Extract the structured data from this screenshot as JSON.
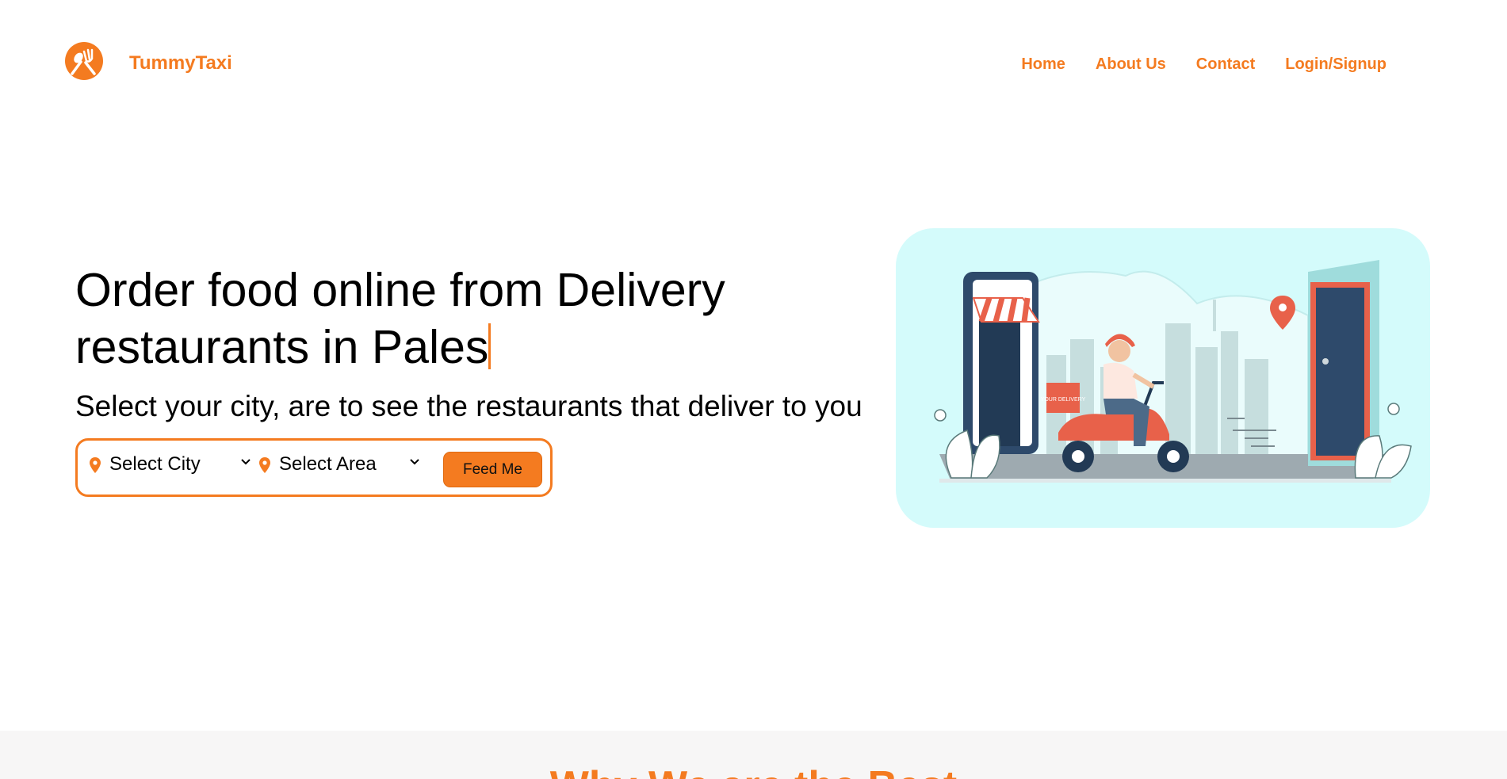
{
  "brand": {
    "name": "TummyTaxi"
  },
  "nav": {
    "home": "Home",
    "about": "About Us",
    "contact": "Contact",
    "login": "Login/Signup"
  },
  "hero": {
    "title_line1": "Order food online from Delivery",
    "title_line2": "restaurants in Pales",
    "subtitle": "Select your city, are to see the restaurants that deliver to you"
  },
  "search": {
    "city_label": "Select City",
    "area_label": "Select Area",
    "button_label": "Feed Me"
  },
  "illustration": {
    "box_text": "YOUR DELIVERY"
  },
  "section": {
    "why_title": "Why We are the Best"
  },
  "colors": {
    "accent": "#f47b20",
    "illus_bg": "#d4fbfb",
    "band_bg": "#f7f6f6"
  },
  "icons": [
    "fork-spoon-logo-icon",
    "location-pin-icon",
    "chevron-down-icon"
  ]
}
